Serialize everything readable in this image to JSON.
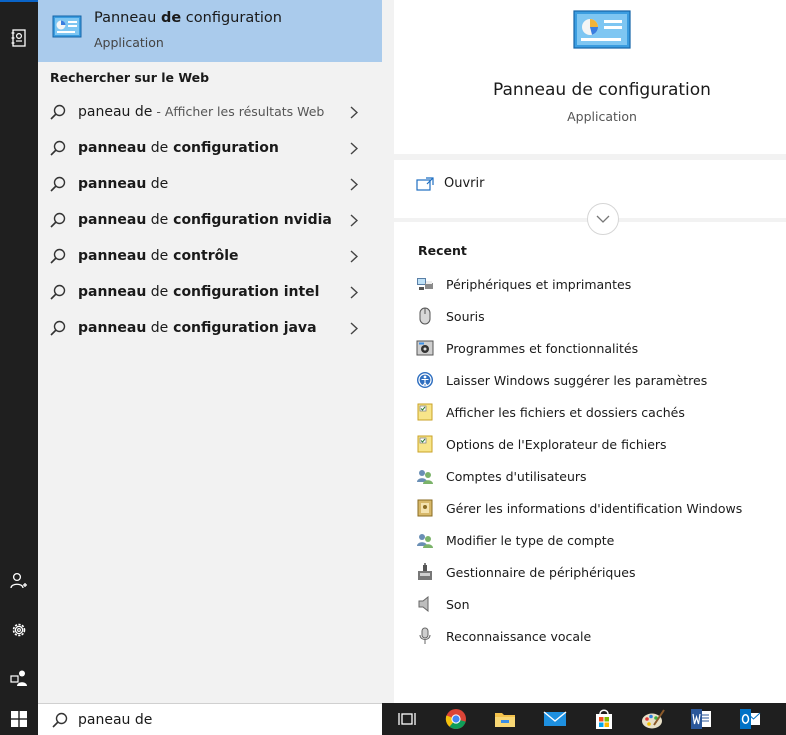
{
  "best_match": {
    "title_prefix": "Panneau ",
    "title_bold": "de",
    "title_suffix": " configuration",
    "subtitle": "Application",
    "icon": "control-panel-icon"
  },
  "web_section": {
    "heading": "Rechercher sur le Web",
    "suggestions": [
      {
        "lead": "paneau de",
        "rest": "",
        "hint": " - Afficher les résultats Web"
      },
      {
        "lead": "panneau",
        "rest": " configuration",
        "hint": ""
      },
      {
        "lead": "panneau",
        "rest": "",
        "hint": ""
      },
      {
        "lead": "panneau",
        "rest": " configuration nvidia",
        "hint": ""
      },
      {
        "lead": "panneau",
        "rest": " contrôle",
        "hint": ""
      },
      {
        "lead": "panneau",
        "rest": " configuration intel",
        "hint": ""
      },
      {
        "lead": "panneau",
        "rest": " configuration java",
        "hint": ""
      }
    ],
    "match_word": " de"
  },
  "detail": {
    "title": "Panneau de configuration",
    "subtitle": "Application",
    "open_label": "Ouvrir",
    "recent_heading": "Recent",
    "recent_items": [
      {
        "label": "Périphériques et imprimantes",
        "icon": "devices-printers-icon"
      },
      {
        "label": "Souris",
        "icon": "mouse-icon"
      },
      {
        "label": "Programmes et fonctionnalités",
        "icon": "programs-icon"
      },
      {
        "label": "Laisser Windows suggérer les paramètres",
        "icon": "ease-of-access-icon"
      },
      {
        "label": "Afficher les fichiers et dossiers cachés",
        "icon": "folder-options-icon"
      },
      {
        "label": "Options de l'Explorateur de fichiers",
        "icon": "folder-options-icon"
      },
      {
        "label": "Comptes d'utilisateurs",
        "icon": "user-accounts-icon"
      },
      {
        "label": "Gérer les informations d'identification Windows",
        "icon": "credential-manager-icon"
      },
      {
        "label": "Modifier le type de compte",
        "icon": "user-accounts-icon"
      },
      {
        "label": "Gestionnaire de périphériques",
        "icon": "device-manager-icon"
      },
      {
        "label": "Son",
        "icon": "speaker-icon"
      },
      {
        "label": "Reconnaissance vocale",
        "icon": "microphone-icon"
      }
    ]
  },
  "search_box": {
    "query": "paneau de"
  },
  "taskbar": {
    "apps": [
      "task-view-icon",
      "chrome-icon",
      "file-explorer-icon",
      "mail-icon",
      "store-icon",
      "paint-icon",
      "word-icon",
      "outlook-icon"
    ]
  },
  "colors": {
    "highlight": "#aacbec",
    "rail": "#1f1f1f",
    "panel_bg": "#f2f2f2",
    "accent": "#0a64c8"
  }
}
